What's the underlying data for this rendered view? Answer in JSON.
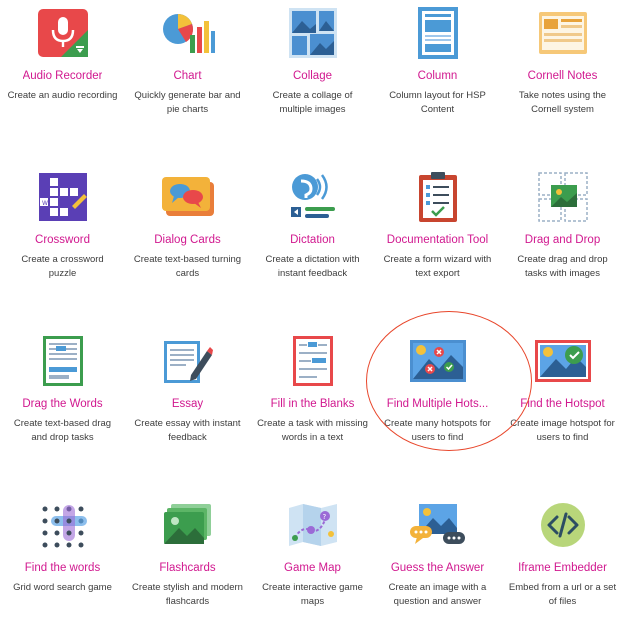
{
  "content_types": [
    {
      "title": "Audio Recorder",
      "desc": "Create an audio recording",
      "icon": "microphone-icon"
    },
    {
      "title": "Chart",
      "desc": "Quickly generate bar and pie charts",
      "icon": "chart-icon"
    },
    {
      "title": "Collage",
      "desc": "Create a collage of multiple images",
      "icon": "collage-icon"
    },
    {
      "title": "Column",
      "desc": "Column layout for HSP Content",
      "icon": "column-icon"
    },
    {
      "title": "Cornell Notes",
      "desc": "Take notes using the Cornell system",
      "icon": "notes-icon"
    },
    {
      "title": "Crossword",
      "desc": "Create a crossword puzzle",
      "icon": "crossword-icon"
    },
    {
      "title": "Dialog Cards",
      "desc": "Create text-based turning cards",
      "icon": "dialog-cards-icon"
    },
    {
      "title": "Dictation",
      "desc": "Create a dictation with instant feedback",
      "icon": "dictation-icon"
    },
    {
      "title": "Documentation Tool",
      "desc": "Create a form wizard with text export",
      "icon": "clipboard-icon"
    },
    {
      "title": "Drag and Drop",
      "desc": "Create drag and drop tasks with images",
      "icon": "drag-drop-icon"
    },
    {
      "title": "Drag the Words",
      "desc": "Create text-based drag and drop tasks",
      "icon": "drag-words-icon"
    },
    {
      "title": "Essay",
      "desc": "Create essay with instant feedback",
      "icon": "essay-icon"
    },
    {
      "title": "Fill in the Blanks",
      "desc": "Create a task with missing words in a text",
      "icon": "fill-blanks-icon"
    },
    {
      "title": "Find Multiple Hots...",
      "desc": "Create many hotspots for users to find",
      "icon": "multiple-hotspots-icon"
    },
    {
      "title": "Find the Hotspot",
      "desc": "Create image hotspot for users to find",
      "icon": "hotspot-icon"
    },
    {
      "title": "Find the words",
      "desc": "Grid word search game",
      "icon": "word-search-icon"
    },
    {
      "title": "Flashcards",
      "desc": "Create stylish and modern flashcards",
      "icon": "flashcards-icon"
    },
    {
      "title": "Game Map",
      "desc": "Create interactive game maps",
      "icon": "game-map-icon"
    },
    {
      "title": "Guess the Answer",
      "desc": "Create an image with a question and answer",
      "icon": "guess-answer-icon"
    },
    {
      "title": "Iframe Embedder",
      "desc": "Embed from a url or a set of files",
      "icon": "code-embed-icon"
    }
  ],
  "colors": {
    "title": "#d1188f",
    "desc": "#3d3d3d",
    "highlight": "#e8462b"
  }
}
